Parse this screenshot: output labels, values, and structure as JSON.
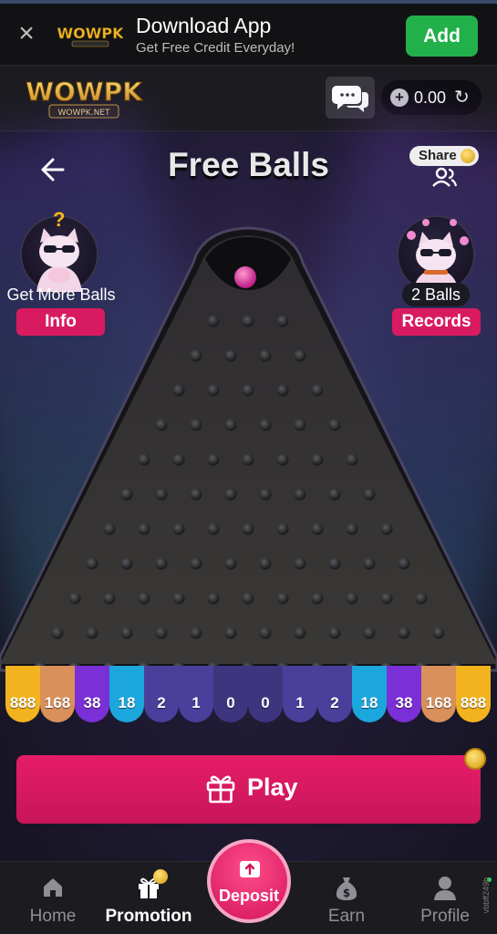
{
  "banner": {
    "title": "Download App",
    "subtitle": "Get Free Credit Everyday!",
    "add_label": "Add",
    "logo_text": "WOWPK"
  },
  "header": {
    "logo_text": "WOWPK",
    "logo_sub": "WOWPK.NET",
    "balance": "0.00"
  },
  "game": {
    "title": "Free Balls",
    "share_label": "Share",
    "left_caption": "Get More Balls",
    "left_button": "Info",
    "right_caption": "2 Balls",
    "right_button": "Records",
    "slots": [
      {
        "value": "888",
        "color": "#f2b31f"
      },
      {
        "value": "168",
        "color": "#d9905a"
      },
      {
        "value": "38",
        "color": "#7b2fd6"
      },
      {
        "value": "18",
        "color": "#1ba7dd"
      },
      {
        "value": "2",
        "color": "#4b3f9c"
      },
      {
        "value": "1",
        "color": "#4b3f9c"
      },
      {
        "value": "0",
        "color": "#3e357f"
      },
      {
        "value": "0",
        "color": "#3e357f"
      },
      {
        "value": "1",
        "color": "#4b3f9c"
      },
      {
        "value": "2",
        "color": "#4b3f9c"
      },
      {
        "value": "18",
        "color": "#1ba7dd"
      },
      {
        "value": "38",
        "color": "#7b2fd6"
      },
      {
        "value": "168",
        "color": "#d9905a"
      },
      {
        "value": "888",
        "color": "#f2b31f"
      }
    ],
    "play_label": "Play"
  },
  "nav": {
    "home": "Home",
    "promotion": "Promotion",
    "deposit": "Deposit",
    "earn": "Earn",
    "profile": "Profile"
  },
  "build_id": "vbbff249b",
  "colors": {
    "accent": "#d81b60",
    "add_green": "#22b04b",
    "gold": "#f2b31f"
  }
}
